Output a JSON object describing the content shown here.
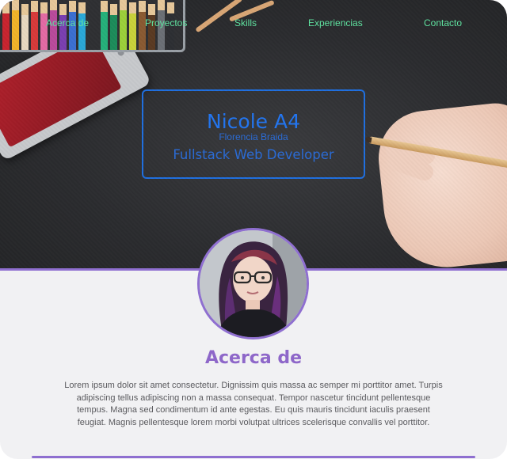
{
  "nav": {
    "items": [
      {
        "label": "Acerca de"
      },
      {
        "label": "Proyectos"
      },
      {
        "label": "Skills"
      },
      {
        "label": "Experiencias"
      },
      {
        "label": "Contacto"
      }
    ]
  },
  "hero": {
    "name": "Nicole A4",
    "subtitle": "Florencia Braida",
    "role": "Fullstack Web Developer"
  },
  "about": {
    "title": "Acerca de",
    "text": "Lorem ipsum dolor sit amet consectetur. Dignissim quis massa ac semper mi porttitor amet. Turpis adipiscing tellus adipiscing non a massa consequat. Tempor nascetur tincidunt pellentesque tempus. Magna sed condimentum id ante egestas. Eu quis mauris tincidunt iaculis praesent feugiat. Magnis pellentesque lorem morbi volutpat ultrices scelerisque convallis vel porttitor."
  },
  "colors": {
    "nav_link": "#5fe3a0",
    "title_blue": "#2275f0",
    "accent_purple": "#8e67c9",
    "hero_background": "#2b2c2f",
    "section_background": "#f1f1f3"
  }
}
